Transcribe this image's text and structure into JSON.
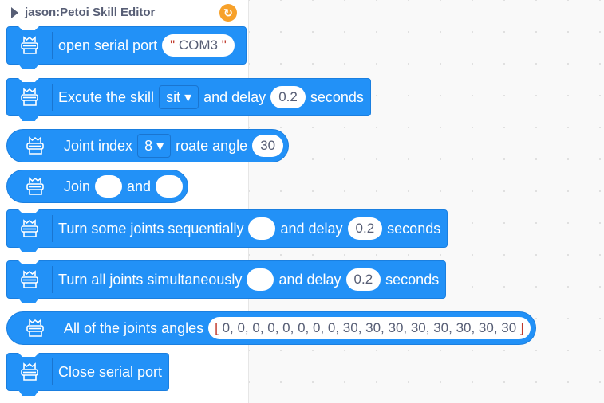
{
  "header": {
    "title": "jason:Petoi Skill Editor",
    "icon": "refresh-badge-icon"
  },
  "colors": {
    "block": "#2291f7",
    "badge": "#f7a12a"
  },
  "blocks": {
    "open_port": {
      "label": "open serial port",
      "value": "COM3",
      "quote": "\""
    },
    "execute": {
      "label": "Excute the skill",
      "skill": "sit",
      "mid": "and delay",
      "delay": "0.2",
      "end": "seconds"
    },
    "joint": {
      "label": "Joint index",
      "index": "8",
      "mid": "roate angle",
      "angle": "30"
    },
    "join": {
      "label": "Join",
      "mid": "and"
    },
    "turn_seq": {
      "label": "Turn some joints sequentially",
      "mid": "and delay",
      "delay": "0.2",
      "end": "seconds"
    },
    "turn_all": {
      "label": "Turn all joints simultaneously",
      "mid": "and delay",
      "delay": "0.2",
      "end": "seconds"
    },
    "all_angles": {
      "label": "All of the joints angles",
      "open": "[",
      "values": "0, 0, 0, 0, 0, 0, 0, 0, 30, 30, 30, 30, 30, 30, 30, 30",
      "close": "]"
    },
    "close_port": {
      "label": "Close serial port"
    }
  }
}
